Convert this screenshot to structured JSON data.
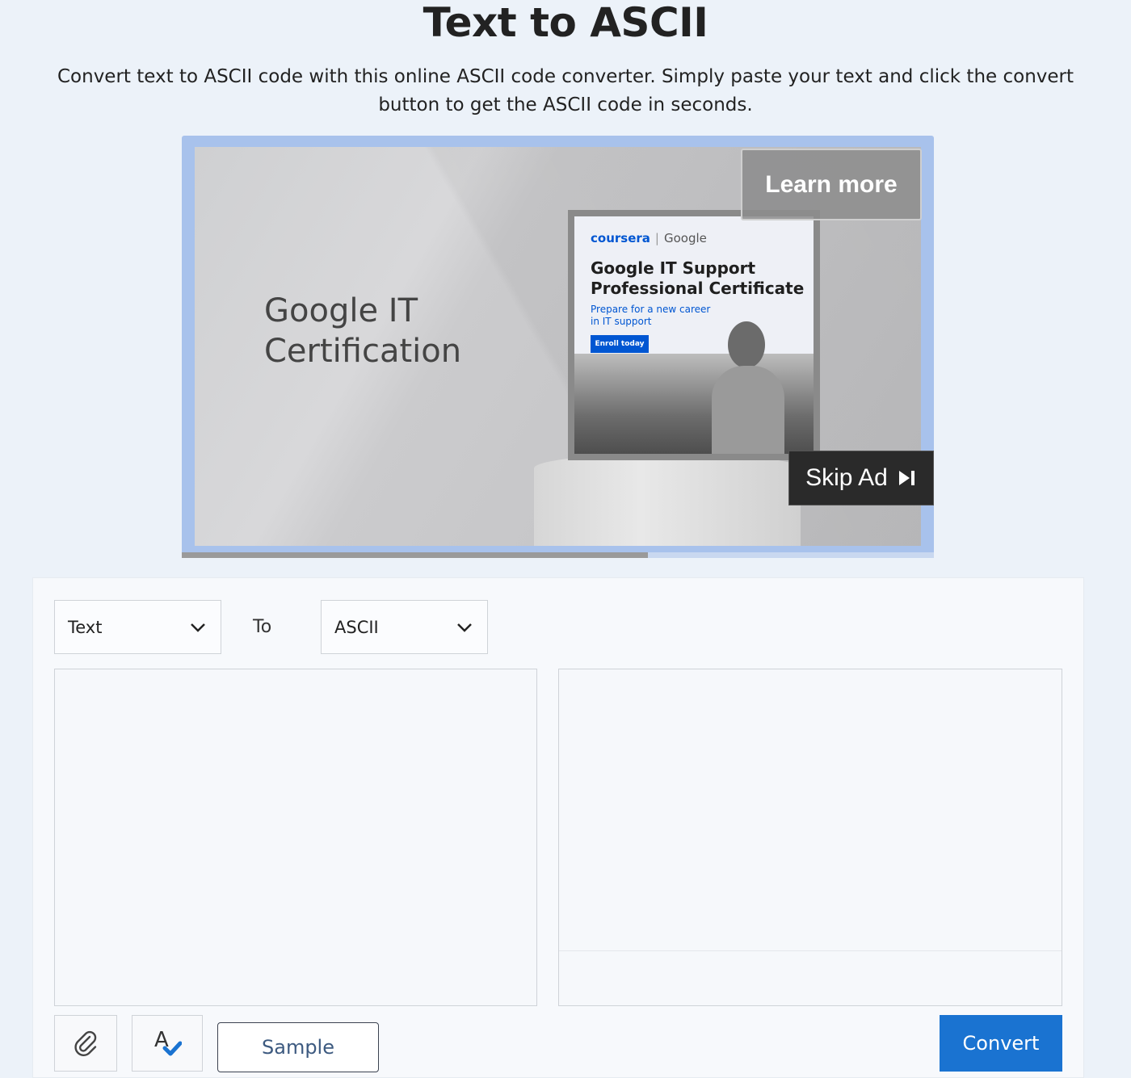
{
  "header": {
    "title": "Text to ASCII",
    "description": "Convert text to ASCII code with this online ASCII code converter. Simply paste your text and click the convert button to get the ASCII code in seconds."
  },
  "ad": {
    "headline_line1": "Google IT",
    "headline_line2": "Certification",
    "poster_brand_coursera": "coursera",
    "poster_brand_google": "Google",
    "poster_title_line1": "Google IT Support",
    "poster_title_line2": "Professional Certificate",
    "poster_subtitle_line1": "Prepare for a new career",
    "poster_subtitle_line2": "in IT support",
    "poster_cta": "Enroll today",
    "learn_more_label": "Learn more",
    "skip_label": "Skip Ad",
    "skip_icon": "skip-next-icon",
    "progress_percent": 62
  },
  "converter": {
    "from_value": "Text",
    "to_label": "To",
    "to_value": "ASCII",
    "input_text": "",
    "output_text": "",
    "attach_icon": "paperclip-icon",
    "spellcheck_icon": "spellcheck-icon",
    "sample_label": "Sample",
    "convert_label": "Convert"
  },
  "colors": {
    "page_bg": "#ecf2f9",
    "ad_frame": "#a8c2ec",
    "convert_bg": "#1a73d1",
    "coursera_blue": "#0056d2"
  }
}
